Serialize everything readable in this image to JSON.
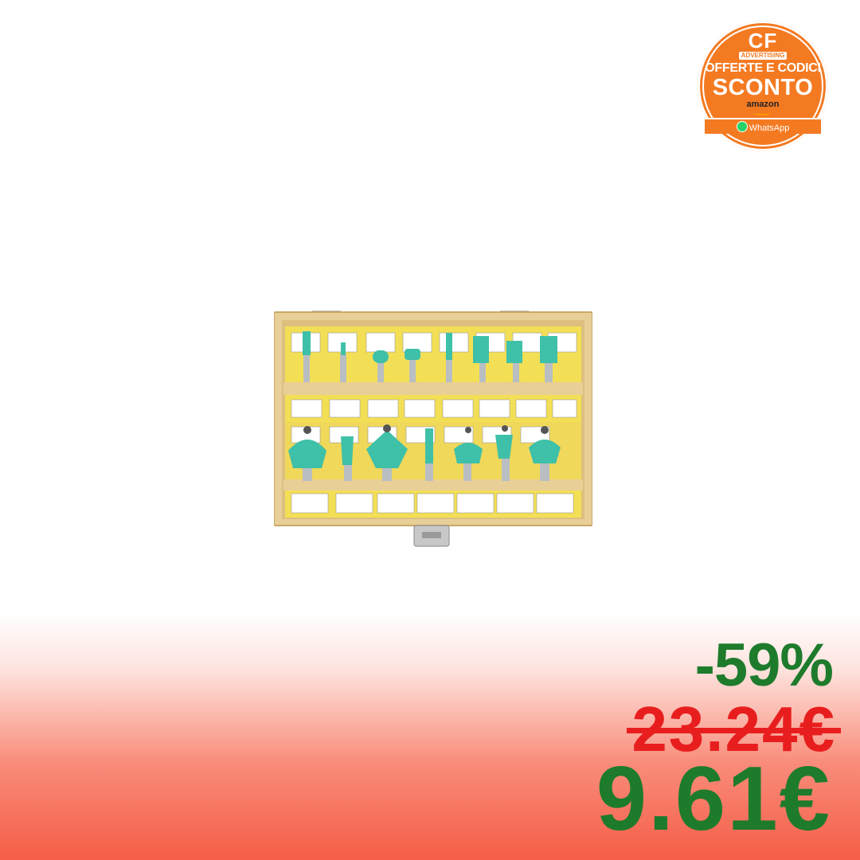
{
  "badge": {
    "brand": "CF",
    "tag": "ADVERTISING",
    "line1": "OFFERTE E CODICI",
    "line2": "SCONTO",
    "store": "amazon",
    "channel": "WhatsApp",
    "icon": "whatsapp-icon",
    "color": "#f47a22"
  },
  "product": {
    "icon": "router-bit-set-image",
    "box_color": "#e9cf96",
    "bit_color": "#3fc0a8",
    "label_color": "#f3df55"
  },
  "pricing": {
    "discount": "-59%",
    "old_price": "23.24€",
    "new_price": "9.61€",
    "discount_color": "#1e7b2c",
    "old_price_color": "#e81e1e"
  }
}
